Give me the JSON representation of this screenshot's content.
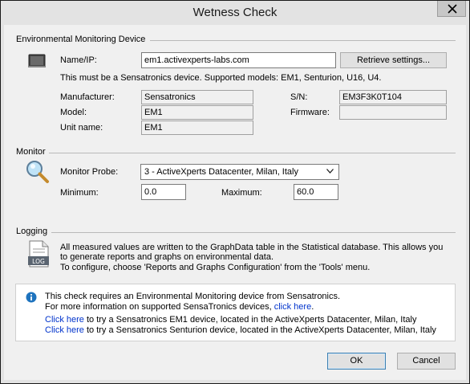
{
  "window": {
    "title": "Wetness Check"
  },
  "device_section": {
    "title": "Environmental Monitoring Device",
    "name_label": "Name/IP:",
    "name_value": "em1.activexperts-labs.com",
    "retrieve_button": "Retrieve settings...",
    "note": "This must be a Sensatronics device. Supported models:  EM1, Senturion, U16, U4.",
    "manufacturer_label": "Manufacturer:",
    "manufacturer_value": "Sensatronics",
    "model_label": "Model:",
    "model_value": "EM1",
    "unit_label": "Unit name:",
    "unit_value": "EM1",
    "sn_label": "S/N:",
    "sn_value": "EM3F3K0T104",
    "firmware_label": "Firmware:",
    "firmware_value": ""
  },
  "monitor_section": {
    "title": "Monitor",
    "probe_label": "Monitor Probe:",
    "probe_value": "3 - ActiveXperts Datacenter, Milan, Italy",
    "min_label": "Minimum:",
    "min_value": "0.0",
    "max_label": "Maximum:",
    "max_value": "60.0"
  },
  "logging_section": {
    "title": "Logging",
    "icon_text": "LOG",
    "line1": "All measured values are written to the GraphData table in the Statistical database. This allows you",
    "line2": "to generate reports and graphs on environmental data.",
    "line3": "To configure, choose 'Reports and Graphs Configuration' from the 'Tools' menu."
  },
  "info_panel": {
    "line1": "This check requires an Environmental Monitoring device from Sensatronics.",
    "line2_text": "For more information on supported SensaTronics devices,",
    "line2_link": "click here",
    "line3_link": "Click here",
    "line3_text": "to try a Sensatronics EM1 device, located in the ActiveXperts Datacenter, Milan, Italy",
    "line4_link": "Click here",
    "line4_text": "to try a Sensatronics Senturion device, located in the ActiveXperts Datacenter, Milan, Italy"
  },
  "footer": {
    "ok": "OK",
    "cancel": "Cancel"
  },
  "colors": {
    "link": "#0033cc",
    "info_icon": "#1e73be"
  }
}
